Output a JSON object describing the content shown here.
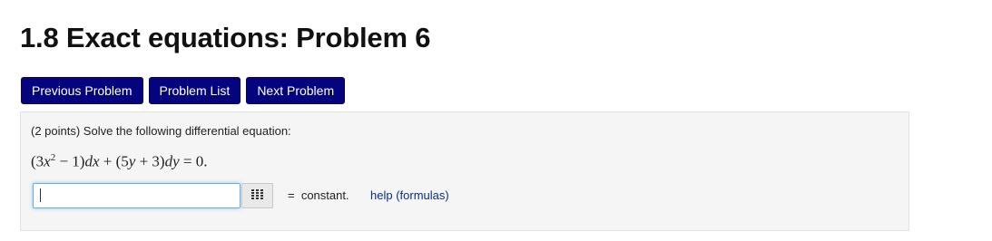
{
  "page": {
    "title": "1.8 Exact equations: Problem 6"
  },
  "nav": {
    "previous_label": "Previous Problem",
    "list_label": "Problem List",
    "next_label": "Next Problem"
  },
  "problem": {
    "intro": "(2 points) Solve the following differential equation:",
    "equation": {
      "open1": "(3",
      "x": "x",
      "exp": "2",
      "minus_one": " − 1)",
      "dx": "dx",
      "plus": " + (5",
      "y": "y",
      "plus3": " + 3)",
      "dy": "dy",
      "rhs": " = 0."
    },
    "answer": {
      "value": "",
      "placeholder": ""
    },
    "editor_icon": "grid-icon",
    "suffix": "=  constant.",
    "help_link": "help (formulas)"
  },
  "colors": {
    "button_bg": "#05047e",
    "box_bg": "#f5f5f5",
    "input_focus": "#66afe9",
    "link": "#0b2c8c"
  }
}
